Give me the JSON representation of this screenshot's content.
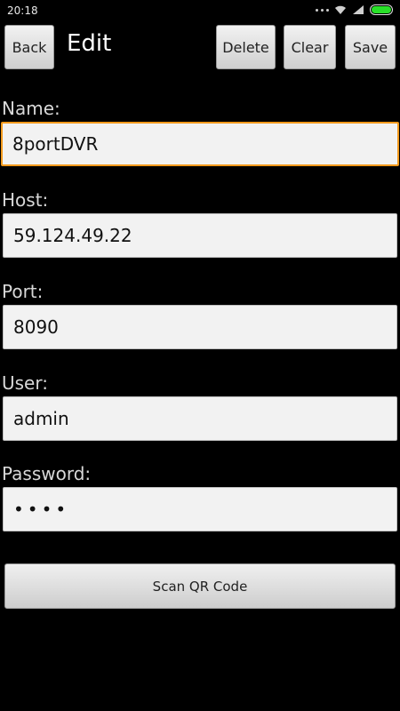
{
  "status": {
    "time": "20:18"
  },
  "toolbar": {
    "back_label": "Back",
    "title": "Edit",
    "delete_label": "Delete",
    "clear_label": "Clear",
    "save_label": "Save"
  },
  "form": {
    "name": {
      "label": "Name:",
      "value": "8portDVR"
    },
    "host": {
      "label": "Host:",
      "value": "59.124.49.22"
    },
    "port": {
      "label": "Port:",
      "value": "8090"
    },
    "user": {
      "label": "User:",
      "value": "admin"
    },
    "password": {
      "label": "Password:",
      "value": "••••"
    }
  },
  "scan_button_label": "Scan QR Code",
  "colors": {
    "focus": "#f39a1c",
    "battery": "#28e028"
  }
}
